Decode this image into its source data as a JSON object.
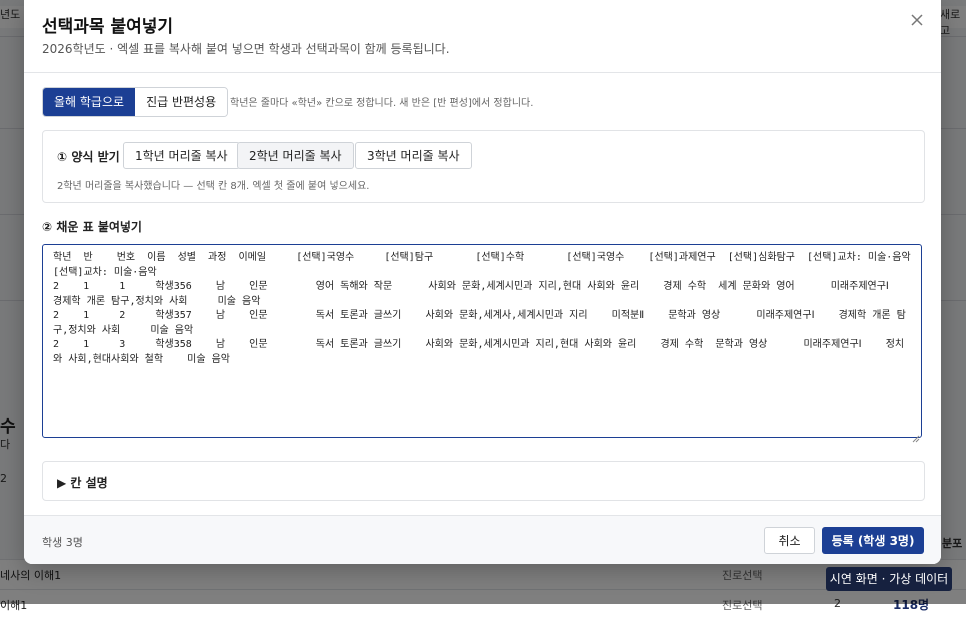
{
  "background": {
    "tab_left": "년도",
    "tab_right": "새로고",
    "left_text_1": "수",
    "left_text_2": "다",
    "left_number": "2",
    "right_tab": "분포",
    "rows": [
      {
        "name": "네사의 이해1",
        "type": "진로선택",
        "count": "",
        "value": ""
      },
      {
        "name": "이해1",
        "type": "진로선택",
        "count": "2",
        "value": "118명"
      }
    ]
  },
  "modal": {
    "title": "선택과목 붙여넣기",
    "subtitle": "2026학년도 · 엑셀 표를 복사해 붙여 넣으면 학생과 선택과목이 함께 등록됩니다.",
    "close_icon": "close-icon",
    "modes": [
      {
        "label": "올해 학급으로",
        "active": true
      },
      {
        "label": "진급 반편성용",
        "active": false
      }
    ],
    "mode_hint": "학년은 줄마다 «학년» 칸으로 정합니다. 새 반은 [반 편성]에서 정합니다.",
    "template": {
      "label": "① 양식 받기",
      "buttons": [
        "1학년 머리줄 복사",
        "2학년 머리줄 복사",
        "3학년 머리줄 복사"
      ],
      "note": "2학년 머리줄을 복사했습니다 — 선택 칸 8개. 엑셀 첫 줄에 붙여 넣으세요."
    },
    "paste_label": "② 채운 표 붙여넣기",
    "paste_value": "학년  반    번호  이름  성별  과정  이메일     [선택]국영수     [선택]탐구       [선택]수학       [선택]국영수    [선택]과제연구  [선택]심화탐구  [선택]교차: 미술·음악     [선택]교차: 미술·음악\n2    1     1     학생356    남    인문        영어 독해와 작문      사회와 문화,세계시민과 지리,현대 사회와 윤리    경제 수학  세계 문화와 영어      미래주제연구Ⅰ    경제학 개론 탐구,정치와 사회     미술 음악\n2    1     2     학생357    남    인문        독서 토론과 글쓰기    사회와 문화,세계사,세계시민과 지리    미적분Ⅱ    문학과 영상      미래주제연구Ⅰ    경제학 개론 탐구,정치와 사회     미술 음악\n2    1     3     학생358    남    인문        독서 토론과 글쓰기    사회와 문화,세계시민과 지리,현대 사회와 윤리    경제 수학  문학과 영상      미래주제연구Ⅰ    정치와 사회,현대사회와 철학    미술 음악",
    "explain_label": "▶ 칸 설명",
    "footer": {
      "count": "학생 3명",
      "cancel": "취소",
      "submit": "등록 (학생 3명)"
    }
  },
  "toast": "시연 화면 · 가상 데이터"
}
